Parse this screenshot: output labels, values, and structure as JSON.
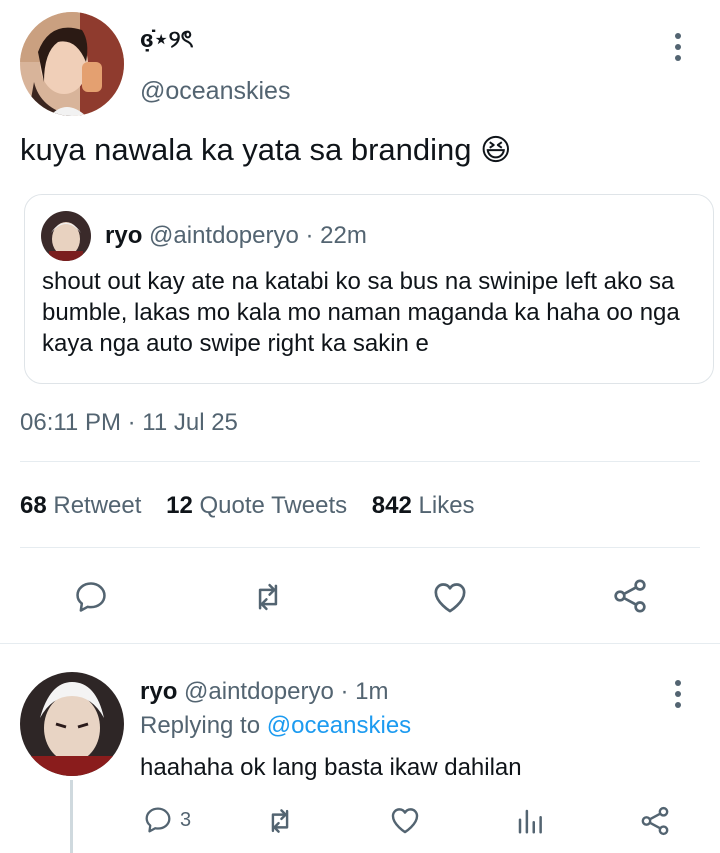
{
  "tweet": {
    "author_name": "ɞ̣̇⋆୨ৎ",
    "author_handle": "@oceanskies",
    "text": "kuya nawala ka yata sa branding",
    "emoji": "😆",
    "timestamp": "06:11 PM · 11 Jul 25"
  },
  "quoted": {
    "name": "ryo",
    "handle": "@aintdoperyo",
    "sep": "·",
    "time": "22m",
    "text": "shout out kay ate na katabi ko sa bus na swinipe left ako sa bumble, lakas mo kala mo naman maganda ka haha oo nga kaya nga auto swipe right ka sakin e"
  },
  "stats": {
    "retweets_count": "68",
    "retweets_label": "Retweet",
    "quotes_count": "12",
    "quotes_label": "Quote Tweets",
    "likes_count": "842",
    "likes_label": "Likes"
  },
  "actions": {
    "icons": [
      "reply-icon",
      "retweet-icon",
      "like-icon",
      "share-icon"
    ]
  },
  "reply": {
    "name": "ryo",
    "handle": "@aintdoperyo",
    "sep": "·",
    "time": "1m",
    "replying_prefix": "Replying to",
    "replying_handle": "@oceanskies",
    "text": "haahaha ok lang basta ikaw dahilan",
    "reply_count": "3",
    "icons": [
      "reply-icon",
      "retweet-icon",
      "like-icon",
      "analytics-icon",
      "share-icon"
    ]
  },
  "colors": {
    "text": "#0f1419",
    "secondary": "#536471",
    "accent": "#1d9bf0",
    "divider": "#e6ecf0"
  }
}
